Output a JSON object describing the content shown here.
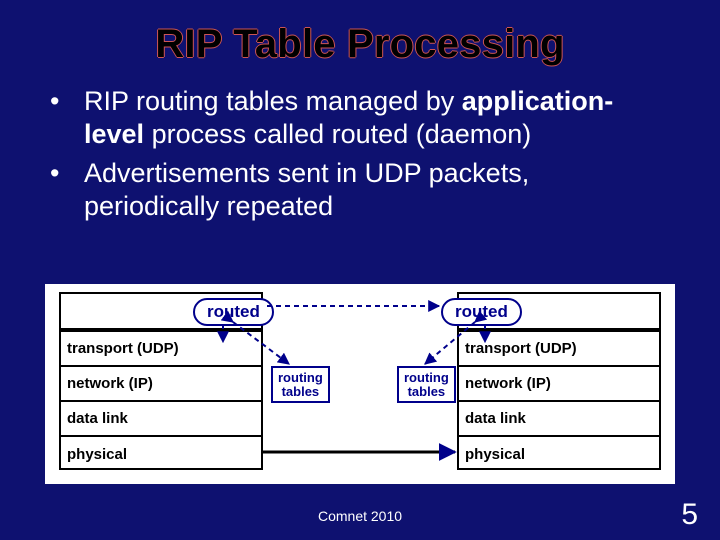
{
  "title": "RIP Table Processing",
  "bullets": [
    {
      "dot": "•",
      "segments": [
        {
          "text": "RIP routing tables managed by ",
          "bold": false
        },
        {
          "text": "application-level",
          "bold": true
        },
        {
          "text": " process called routed (daemon)",
          "bold": false
        }
      ]
    },
    {
      "dot": "•",
      "segments": [
        {
          "text": "Advertisements sent in UDP packets, periodically repeated",
          "bold": false
        }
      ]
    }
  ],
  "diagram": {
    "routed": "routed",
    "layers": [
      "transport (UDP)",
      "network (IP)",
      "data link",
      "physical"
    ],
    "tables": [
      "routing",
      "tables"
    ]
  },
  "footer": "Comnet 2010",
  "pagenum": "5"
}
